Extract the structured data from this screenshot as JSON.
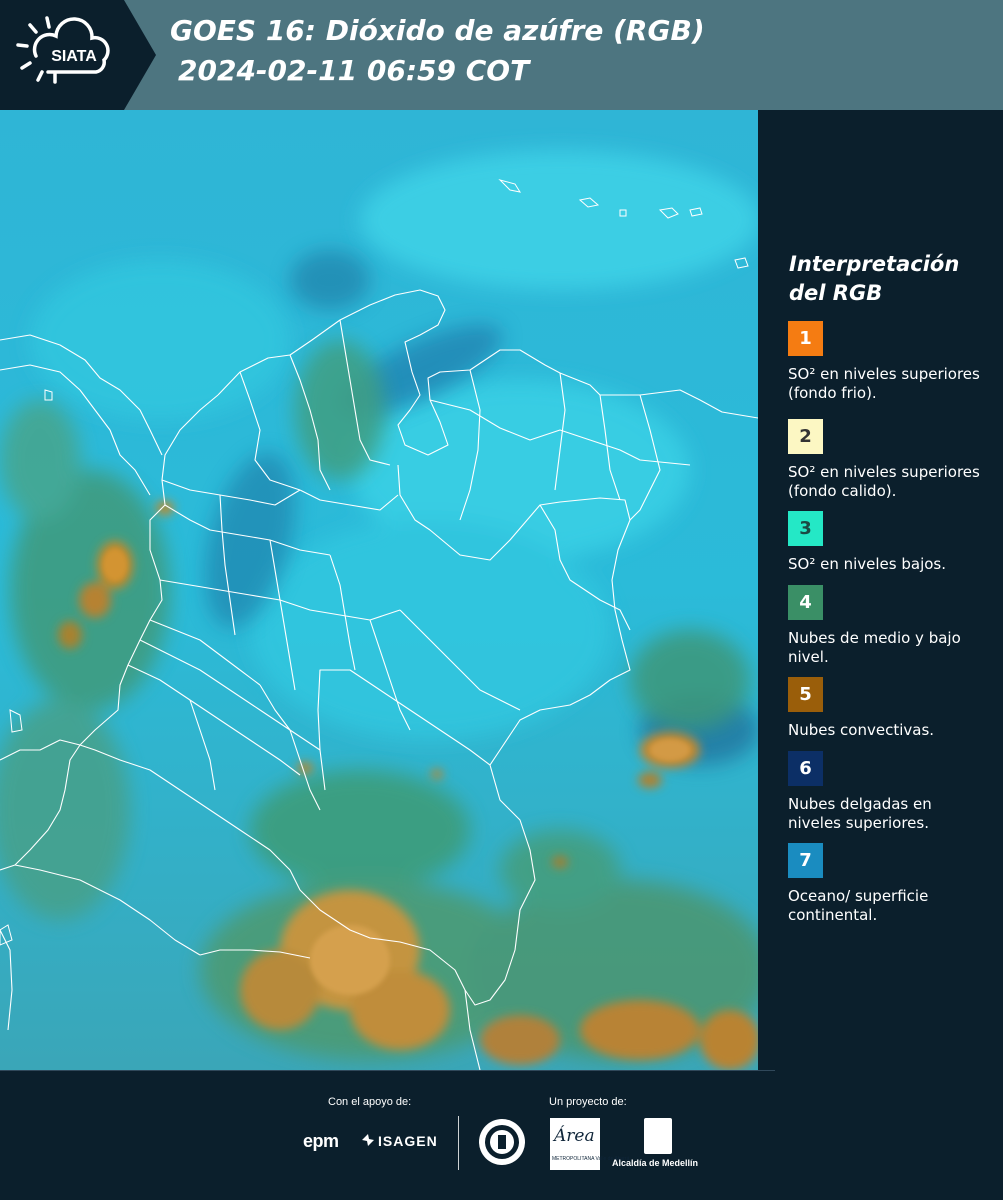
{
  "header": {
    "logo_text": "SIATA",
    "title_line1": "GOES 16: Dióxido de azúfre (RGB)",
    "title_line2": "2024-02-11 06:59 COT"
  },
  "legend": {
    "title": "Interpretación del RGB",
    "items": [
      {
        "number": "1",
        "color": "#f57c12",
        "num_color": "#ffffff",
        "text": "SO² en niveles superiores (fondo frio)."
      },
      {
        "number": "2",
        "color": "#fcf7c3",
        "num_color": "#333333",
        "text": "SO² en niveles superiores (fondo calido)."
      },
      {
        "number": "3",
        "color": "#24e8c6",
        "num_color": "#1b4a44",
        "text": "SO² en niveles bajos."
      },
      {
        "number": "4",
        "color": "#3a8f66",
        "num_color": "#ffffff",
        "text": "Nubes de medio y bajo nivel."
      },
      {
        "number": "5",
        "color": "#9a5e0a",
        "num_color": "#ffffff",
        "text": "Nubes convectivas."
      },
      {
        "number": "6",
        "color": "#0c2f66",
        "num_color": "#ffffff",
        "text": "Nubes delgadas en niveles superiores."
      },
      {
        "number": "7",
        "color": "#1a8cc0",
        "num_color": "#ffffff",
        "text": "Oceano/ superficie continental."
      }
    ]
  },
  "footer": {
    "support_label": "Con el apoyo de:",
    "project_label": "Un proyecto de:",
    "epm": "epm",
    "isagen": "ISAGEN",
    "area_logo": "Área",
    "area_sub": "METROPOLITANA Valle de Aburrá",
    "alcaldia": "Alcaldía de Medellín"
  }
}
